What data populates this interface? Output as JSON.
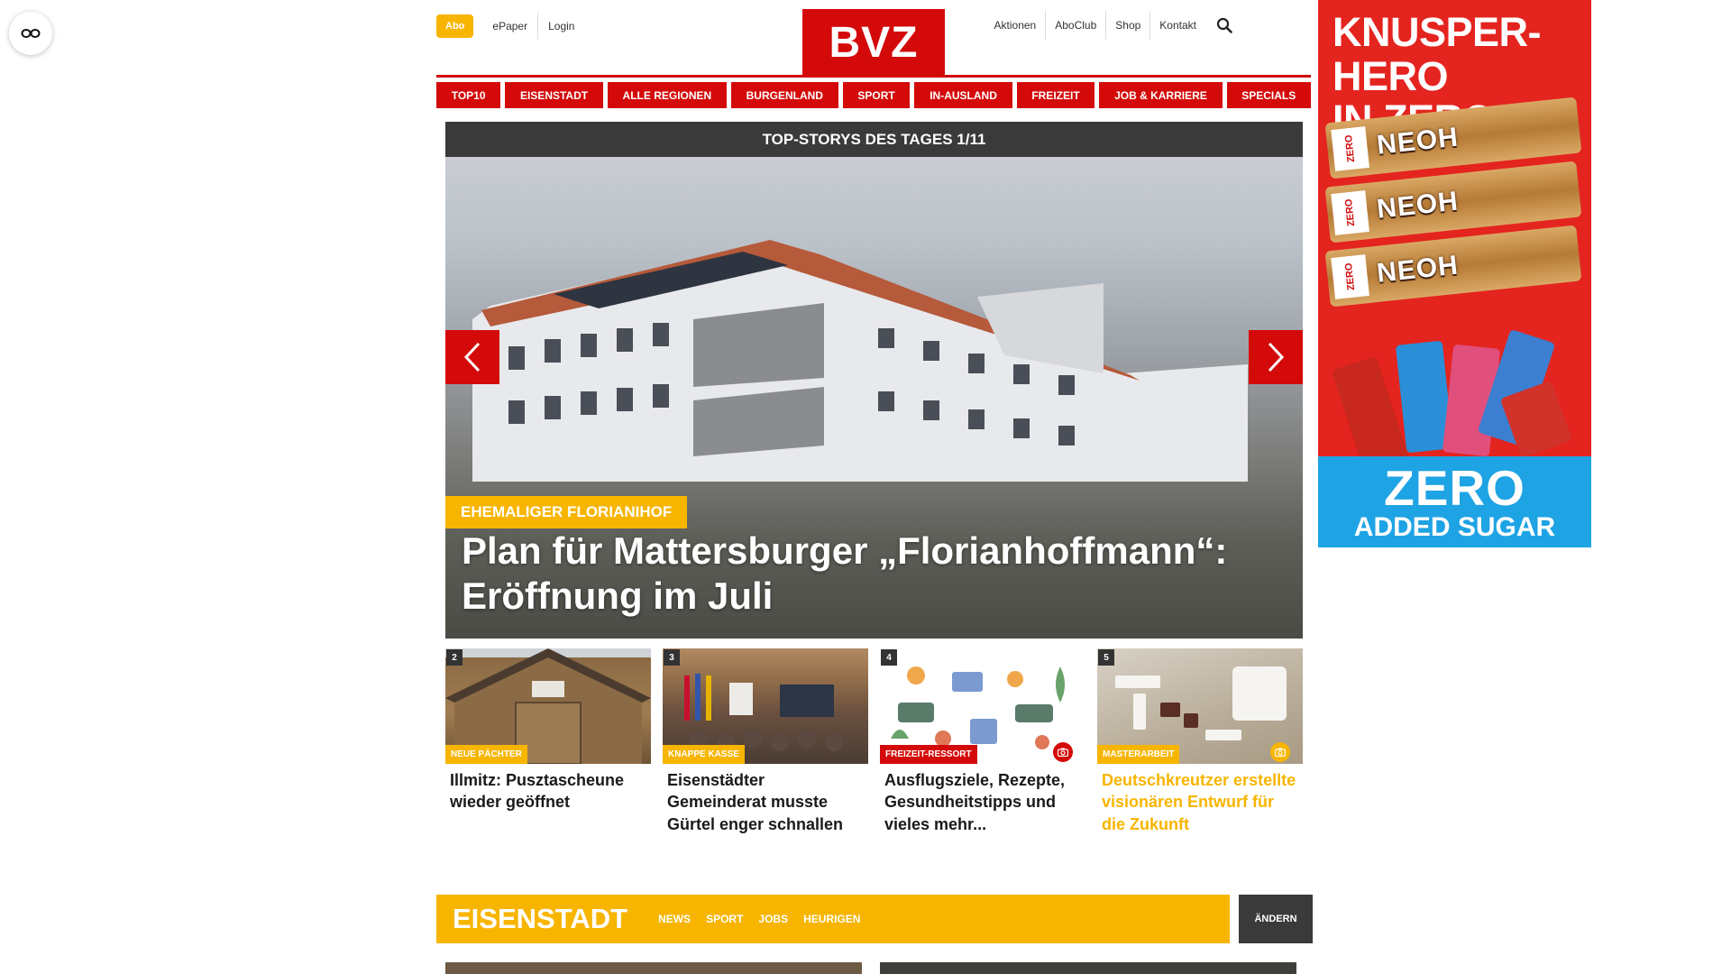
{
  "header": {
    "abo_label": "Abo",
    "epaper_label": "ePaper",
    "login_label": "Login",
    "logo_text": "BVZ",
    "right_links": [
      "Aktionen",
      "AboClub",
      "Shop",
      "Kontakt"
    ]
  },
  "nav": {
    "items": [
      "TOP10",
      "EISENSTADT",
      "ALLE REGIONEN",
      "BURGENLAND",
      "SPORT",
      "IN-AUSLAND",
      "FREIZEIT",
      "JOB & KARRIERE",
      "SPECIALS"
    ]
  },
  "slider": {
    "header": "TOP-STORYS DES TAGES 1/11",
    "tag": "EHEMALIGER FLORIANIHOF",
    "title": "Plan für Mattersburger „Florianhoffmann“: Eröffnung im Juli"
  },
  "teasers": [
    {
      "number": "2",
      "tag": "NEUE PÄCHTER",
      "title": "Illmitz: Pusztascheune wieder geöffnet"
    },
    {
      "number": "3",
      "tag": "KNAPPE KASSE",
      "title": "Eisenstädter Gemeinderat musste Gürtel enger schnallen"
    },
    {
      "number": "4",
      "tag": "FREIZEIT-RESSORT",
      "title": "Ausflugsziele, Rezepte, Gesundheitstipps und vieles mehr..."
    },
    {
      "number": "5",
      "tag": "MASTERARBEIT",
      "title": "Deutschkreutzer erstellte visionären Entwurf für die Zukunft"
    }
  ],
  "region": {
    "name": "EISENSTADT",
    "links": [
      "NEWS",
      "SPORT",
      "JOBS",
      "HEURIGEN"
    ],
    "change_label": "ÄNDERN"
  },
  "ad": {
    "headline_line1": "KNUSPER-HERO",
    "headline_line2": "IN ZERO!",
    "brand": "NEOH",
    "bar_badge": "ZERO",
    "zero": "ZERO",
    "added_sugar": "ADDED SUGAR"
  },
  "colors": {
    "brand_red": "#d40a0a",
    "accent_yellow": "#f7b500",
    "dark": "#3a3a3a",
    "ad_red": "#e4241f",
    "ad_blue": "#1ea3e4"
  },
  "icons": {
    "accessibility": "glasses-icon",
    "search": "search-icon",
    "prev": "chevron-left-icon",
    "next": "chevron-right-icon",
    "camera": "camera-icon"
  }
}
